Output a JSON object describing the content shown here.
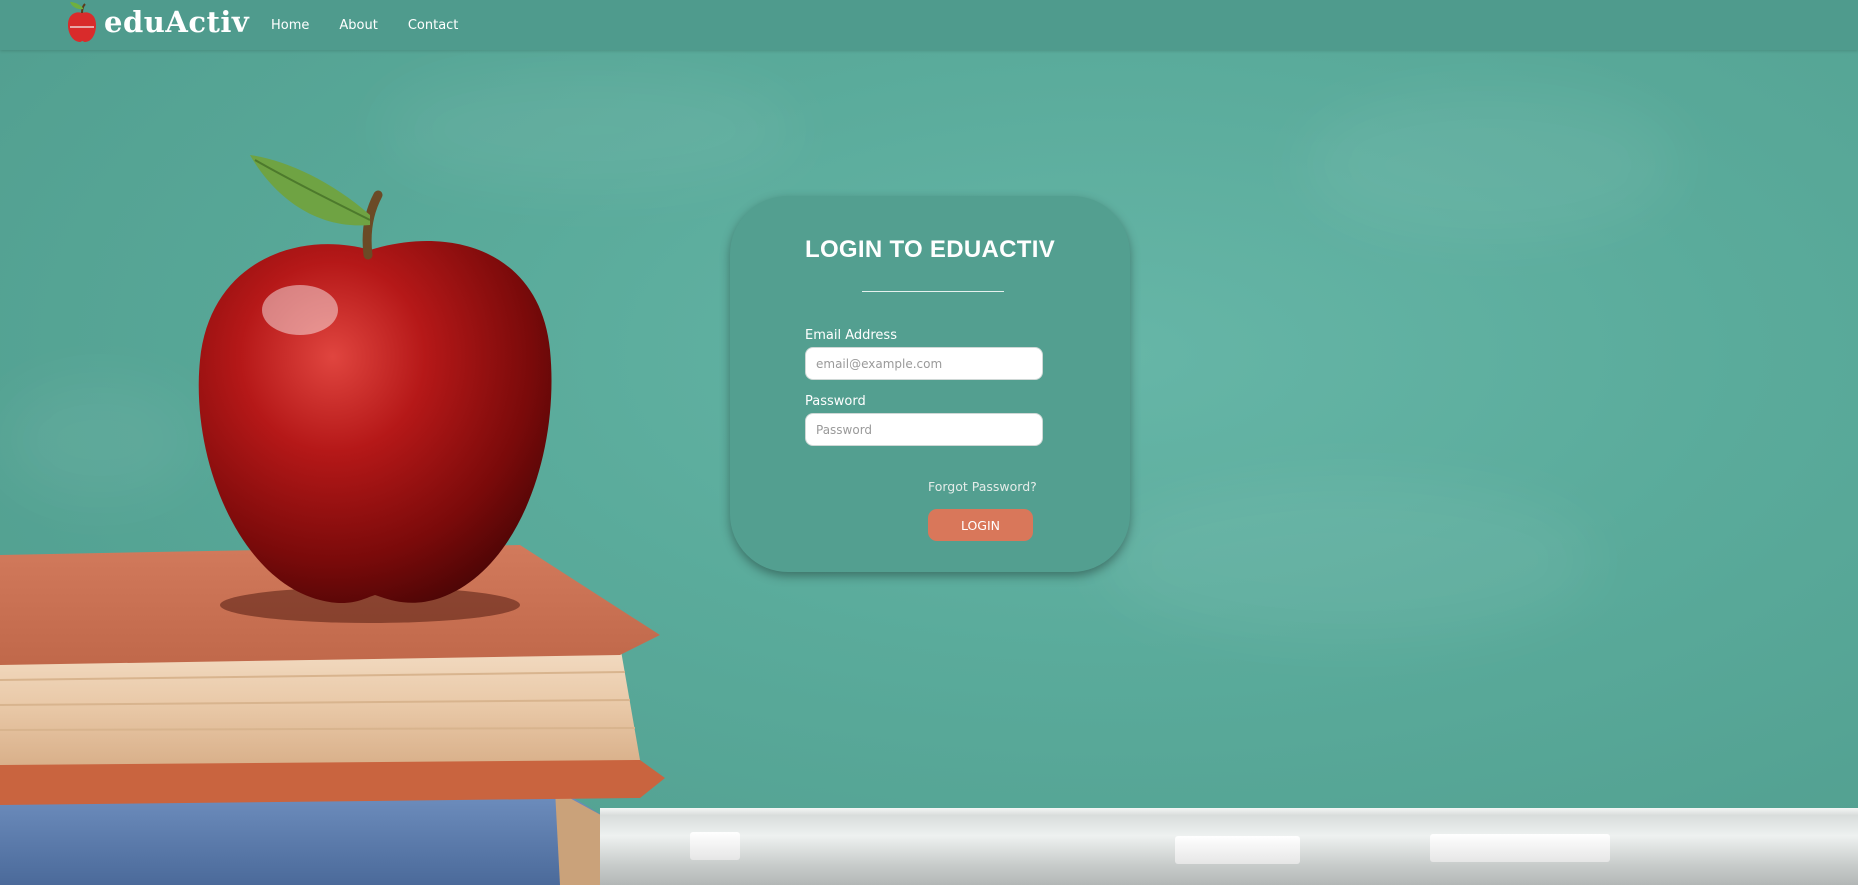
{
  "navbar": {
    "brand_name": "eduActiv",
    "links": [
      "Home",
      "About",
      "Contact"
    ]
  },
  "login": {
    "title": "LOGIN TO EDUACTIV",
    "email_label": "Email Address",
    "email_placeholder": "email@example.com",
    "email_value": "",
    "password_label": "Password",
    "password_placeholder": "Password",
    "password_value": "",
    "forgot_link": "Forgot Password?",
    "submit_label": "LOGIN"
  },
  "colors": {
    "navbar": "#4f9b8d",
    "card": "#539f90",
    "accent_button": "#d9775a",
    "chalkboard": "#5aab9b"
  },
  "icons": {
    "brand_logo": "apple-icon"
  }
}
